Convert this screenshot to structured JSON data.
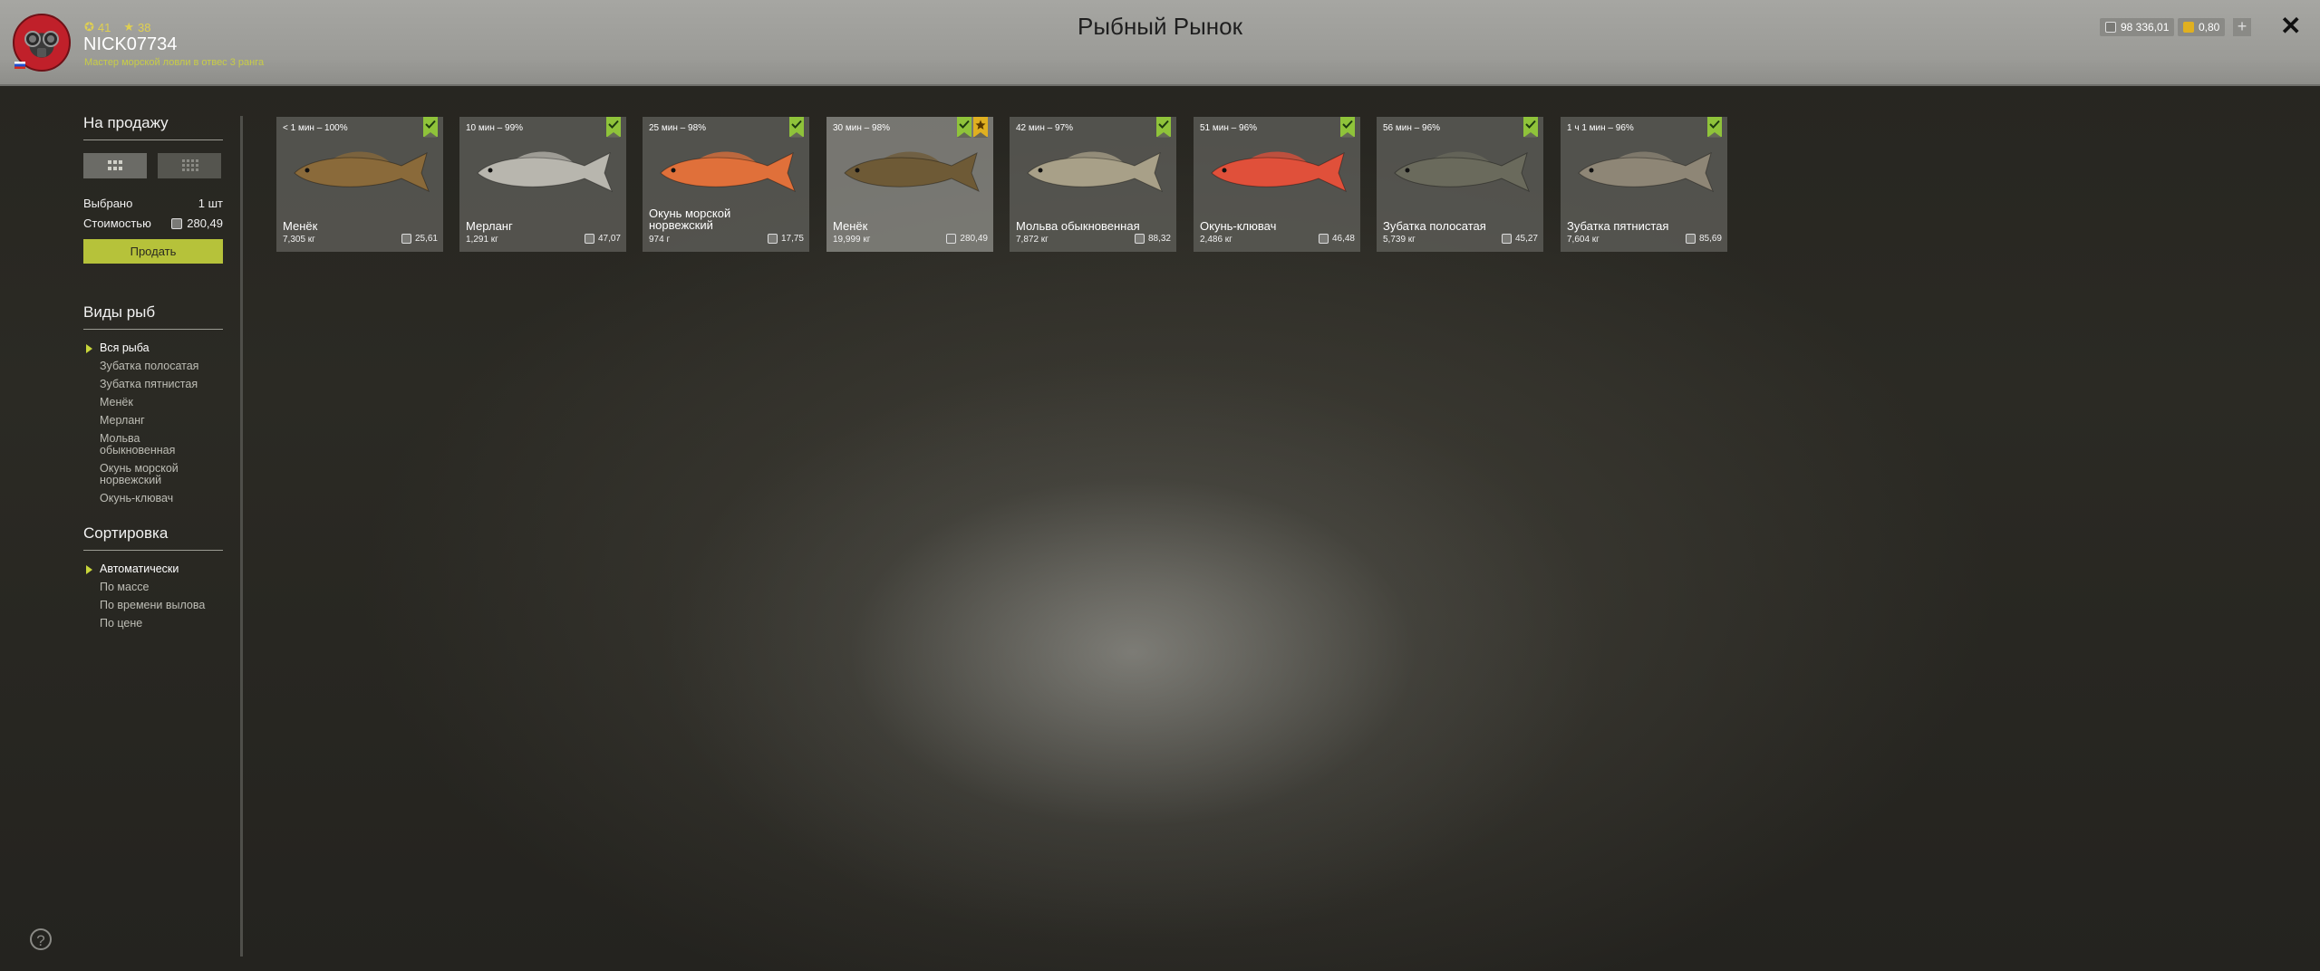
{
  "header": {
    "title": "Рыбный Рынок",
    "player": {
      "stat_level": "41",
      "stat_stars": "38",
      "username": "NICK07734",
      "rank": "Мастер морской ловли в отвес 3 ранга"
    },
    "currency": {
      "silver": "98 336,01",
      "gold": "0,80"
    }
  },
  "sidebar": {
    "for_sale_title": "На продажу",
    "selected_label": "Выбрано",
    "selected_value": "1 шт",
    "cost_label": "Стоимостью",
    "cost_value": "280,49",
    "sell_button": "Продать",
    "species_title": "Виды рыб",
    "species": [
      "Вся рыба",
      "Зубатка полосатая",
      "Зубатка пятнистая",
      "Менёк",
      "Мерланг",
      "Мольва обыкновенная",
      "Окунь морской норвежский",
      "Окунь-клювач"
    ],
    "sort_title": "Сортировка",
    "sort_options": [
      "Автоматически",
      "По массе",
      "По времени вылова",
      "По цене"
    ]
  },
  "fish": [
    {
      "time": "< 1 мин – 100%",
      "name": "Менёк",
      "weight": "7,305 кг",
      "price": "25,61",
      "color": "#8a6a3a",
      "selected": false,
      "starred": false
    },
    {
      "time": "10 мин – 99%",
      "name": "Мерланг",
      "weight": "1,291 кг",
      "price": "47,07",
      "color": "#b8b6ae",
      "selected": false,
      "starred": false
    },
    {
      "time": "25 мин – 98%",
      "name": "Окунь морской норвежский",
      "weight": "974 г",
      "price": "17,75",
      "color": "#e0703a",
      "selected": false,
      "starred": false
    },
    {
      "time": "30 мин – 98%",
      "name": "Менёк",
      "weight": "19,999 кг",
      "price": "280,49",
      "color": "#6e5a36",
      "selected": true,
      "starred": true
    },
    {
      "time": "42 мин – 97%",
      "name": "Мольва обыкновенная",
      "weight": "7,872 кг",
      "price": "88,32",
      "color": "#a8a088",
      "selected": false,
      "starred": false
    },
    {
      "time": "51 мин – 96%",
      "name": "Окунь-клювач",
      "weight": "2,486 кг",
      "price": "46,48",
      "color": "#e0503a",
      "selected": false,
      "starred": false
    },
    {
      "time": "56 мин – 96%",
      "name": "Зубатка полосатая",
      "weight": "5,739 кг",
      "price": "45,27",
      "color": "#6a6a5c",
      "selected": false,
      "starred": false
    },
    {
      "time": "1 ч 1 мин – 96%",
      "name": "Зубатка пятнистая",
      "weight": "7,604 кг",
      "price": "85,69",
      "color": "#8e8676",
      "selected": false,
      "starred": false
    }
  ],
  "help": "?"
}
